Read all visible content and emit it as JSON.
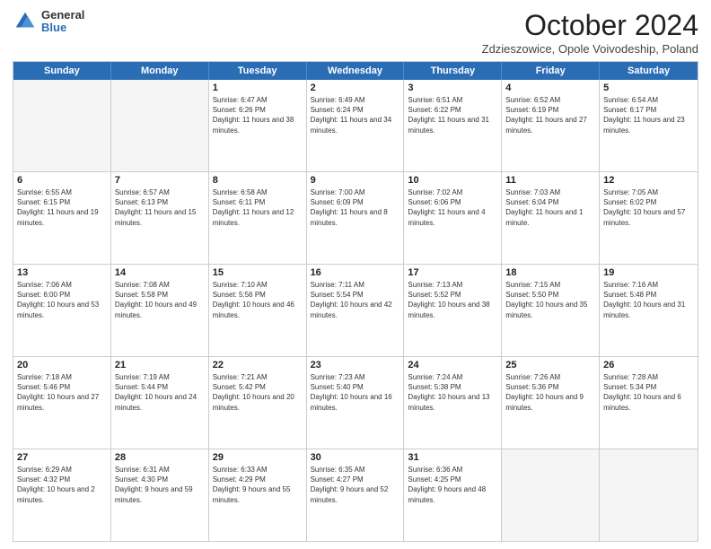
{
  "header": {
    "logo_general": "General",
    "logo_blue": "Blue",
    "title": "October 2024",
    "location": "Zdzieszowice, Opole Voivodeship, Poland"
  },
  "days_of_week": [
    "Sunday",
    "Monday",
    "Tuesday",
    "Wednesday",
    "Thursday",
    "Friday",
    "Saturday"
  ],
  "weeks": [
    [
      {
        "day": "",
        "sunrise": "",
        "sunset": "",
        "daylight": "",
        "empty": true
      },
      {
        "day": "",
        "sunrise": "",
        "sunset": "",
        "daylight": "",
        "empty": true
      },
      {
        "day": "1",
        "sunrise": "Sunrise: 6:47 AM",
        "sunset": "Sunset: 6:26 PM",
        "daylight": "Daylight: 11 hours and 38 minutes."
      },
      {
        "day": "2",
        "sunrise": "Sunrise: 6:49 AM",
        "sunset": "Sunset: 6:24 PM",
        "daylight": "Daylight: 11 hours and 34 minutes."
      },
      {
        "day": "3",
        "sunrise": "Sunrise: 6:51 AM",
        "sunset": "Sunset: 6:22 PM",
        "daylight": "Daylight: 11 hours and 31 minutes."
      },
      {
        "day": "4",
        "sunrise": "Sunrise: 6:52 AM",
        "sunset": "Sunset: 6:19 PM",
        "daylight": "Daylight: 11 hours and 27 minutes."
      },
      {
        "day": "5",
        "sunrise": "Sunrise: 6:54 AM",
        "sunset": "Sunset: 6:17 PM",
        "daylight": "Daylight: 11 hours and 23 minutes."
      }
    ],
    [
      {
        "day": "6",
        "sunrise": "Sunrise: 6:55 AM",
        "sunset": "Sunset: 6:15 PM",
        "daylight": "Daylight: 11 hours and 19 minutes."
      },
      {
        "day": "7",
        "sunrise": "Sunrise: 6:57 AM",
        "sunset": "Sunset: 6:13 PM",
        "daylight": "Daylight: 11 hours and 15 minutes."
      },
      {
        "day": "8",
        "sunrise": "Sunrise: 6:58 AM",
        "sunset": "Sunset: 6:11 PM",
        "daylight": "Daylight: 11 hours and 12 minutes."
      },
      {
        "day": "9",
        "sunrise": "Sunrise: 7:00 AM",
        "sunset": "Sunset: 6:09 PM",
        "daylight": "Daylight: 11 hours and 8 minutes."
      },
      {
        "day": "10",
        "sunrise": "Sunrise: 7:02 AM",
        "sunset": "Sunset: 6:06 PM",
        "daylight": "Daylight: 11 hours and 4 minutes."
      },
      {
        "day": "11",
        "sunrise": "Sunrise: 7:03 AM",
        "sunset": "Sunset: 6:04 PM",
        "daylight": "Daylight: 11 hours and 1 minute."
      },
      {
        "day": "12",
        "sunrise": "Sunrise: 7:05 AM",
        "sunset": "Sunset: 6:02 PM",
        "daylight": "Daylight: 10 hours and 57 minutes."
      }
    ],
    [
      {
        "day": "13",
        "sunrise": "Sunrise: 7:06 AM",
        "sunset": "Sunset: 6:00 PM",
        "daylight": "Daylight: 10 hours and 53 minutes."
      },
      {
        "day": "14",
        "sunrise": "Sunrise: 7:08 AM",
        "sunset": "Sunset: 5:58 PM",
        "daylight": "Daylight: 10 hours and 49 minutes."
      },
      {
        "day": "15",
        "sunrise": "Sunrise: 7:10 AM",
        "sunset": "Sunset: 5:56 PM",
        "daylight": "Daylight: 10 hours and 46 minutes."
      },
      {
        "day": "16",
        "sunrise": "Sunrise: 7:11 AM",
        "sunset": "Sunset: 5:54 PM",
        "daylight": "Daylight: 10 hours and 42 minutes."
      },
      {
        "day": "17",
        "sunrise": "Sunrise: 7:13 AM",
        "sunset": "Sunset: 5:52 PM",
        "daylight": "Daylight: 10 hours and 38 minutes."
      },
      {
        "day": "18",
        "sunrise": "Sunrise: 7:15 AM",
        "sunset": "Sunset: 5:50 PM",
        "daylight": "Daylight: 10 hours and 35 minutes."
      },
      {
        "day": "19",
        "sunrise": "Sunrise: 7:16 AM",
        "sunset": "Sunset: 5:48 PM",
        "daylight": "Daylight: 10 hours and 31 minutes."
      }
    ],
    [
      {
        "day": "20",
        "sunrise": "Sunrise: 7:18 AM",
        "sunset": "Sunset: 5:46 PM",
        "daylight": "Daylight: 10 hours and 27 minutes."
      },
      {
        "day": "21",
        "sunrise": "Sunrise: 7:19 AM",
        "sunset": "Sunset: 5:44 PM",
        "daylight": "Daylight: 10 hours and 24 minutes."
      },
      {
        "day": "22",
        "sunrise": "Sunrise: 7:21 AM",
        "sunset": "Sunset: 5:42 PM",
        "daylight": "Daylight: 10 hours and 20 minutes."
      },
      {
        "day": "23",
        "sunrise": "Sunrise: 7:23 AM",
        "sunset": "Sunset: 5:40 PM",
        "daylight": "Daylight: 10 hours and 16 minutes."
      },
      {
        "day": "24",
        "sunrise": "Sunrise: 7:24 AM",
        "sunset": "Sunset: 5:38 PM",
        "daylight": "Daylight: 10 hours and 13 minutes."
      },
      {
        "day": "25",
        "sunrise": "Sunrise: 7:26 AM",
        "sunset": "Sunset: 5:36 PM",
        "daylight": "Daylight: 10 hours and 9 minutes."
      },
      {
        "day": "26",
        "sunrise": "Sunrise: 7:28 AM",
        "sunset": "Sunset: 5:34 PM",
        "daylight": "Daylight: 10 hours and 6 minutes."
      }
    ],
    [
      {
        "day": "27",
        "sunrise": "Sunrise: 6:29 AM",
        "sunset": "Sunset: 4:32 PM",
        "daylight": "Daylight: 10 hours and 2 minutes."
      },
      {
        "day": "28",
        "sunrise": "Sunrise: 6:31 AM",
        "sunset": "Sunset: 4:30 PM",
        "daylight": "Daylight: 9 hours and 59 minutes."
      },
      {
        "day": "29",
        "sunrise": "Sunrise: 6:33 AM",
        "sunset": "Sunset: 4:29 PM",
        "daylight": "Daylight: 9 hours and 55 minutes."
      },
      {
        "day": "30",
        "sunrise": "Sunrise: 6:35 AM",
        "sunset": "Sunset: 4:27 PM",
        "daylight": "Daylight: 9 hours and 52 minutes."
      },
      {
        "day": "31",
        "sunrise": "Sunrise: 6:36 AM",
        "sunset": "Sunset: 4:25 PM",
        "daylight": "Daylight: 9 hours and 48 minutes."
      },
      {
        "day": "",
        "sunrise": "",
        "sunset": "",
        "daylight": "",
        "empty": true
      },
      {
        "day": "",
        "sunrise": "",
        "sunset": "",
        "daylight": "",
        "empty": true
      }
    ]
  ]
}
